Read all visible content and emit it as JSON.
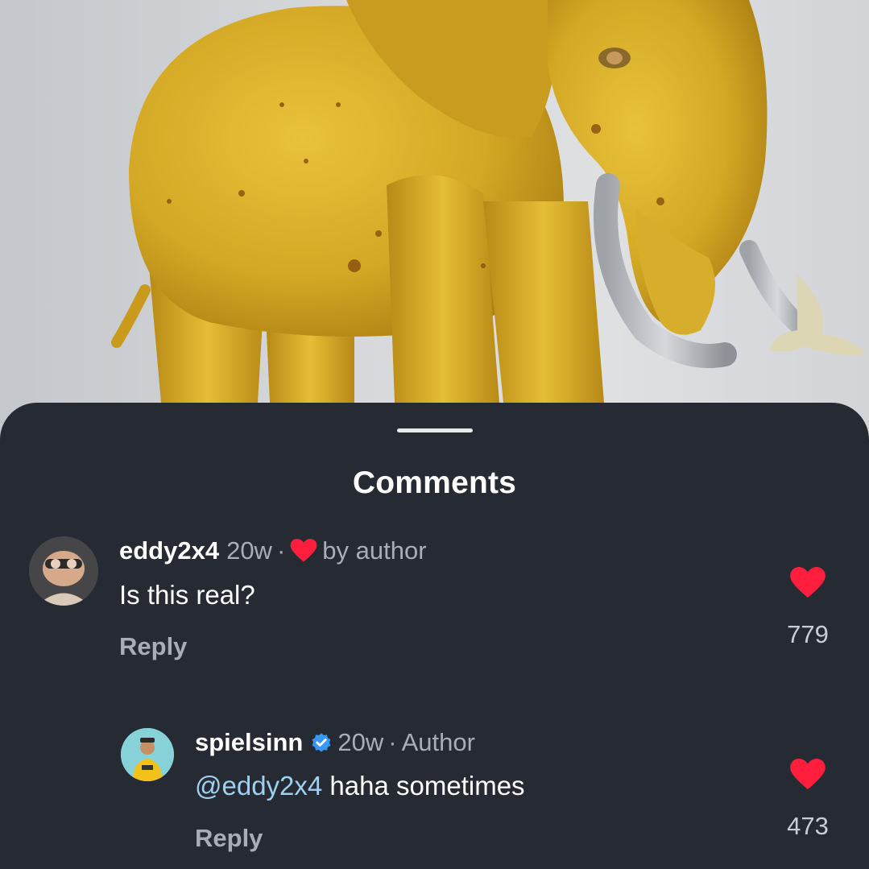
{
  "sheet": {
    "title": "Comments"
  },
  "comments": [
    {
      "username": "eddy2x4",
      "time": "20w",
      "separator": "·",
      "liked_by": "by author",
      "text": "Is this real?",
      "reply_label": "Reply",
      "likes": "779"
    },
    {
      "username": "spielsinn",
      "time": "20w",
      "separator": "·",
      "role": "Author",
      "mention": "@eddy2x4",
      "text": " haha sometimes",
      "reply_label": "Reply",
      "likes": "473"
    }
  ],
  "colors": {
    "sheet_bg": "#252a33",
    "heart": "#ff1f3d",
    "verified": "#3897f0",
    "mention": "#9ed0f0"
  }
}
